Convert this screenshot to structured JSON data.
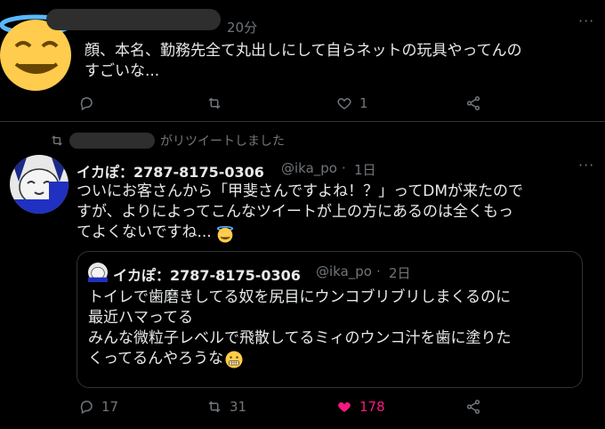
{
  "tweet1": {
    "time": "20分",
    "text_line1": "顔、本名、勤務先全て丸出しにして自らネットの玩具やってんの",
    "text_line2": "すごいな...",
    "retweet_count": "",
    "like_count": "1"
  },
  "retweet_banner": {
    "label": "がリツイートしました"
  },
  "tweet2": {
    "name": "イカぽ：2787-8175-0306",
    "handle": "@ika_po",
    "time": "1日",
    "text_line1": "ついにお客さんから「甲斐さんですよね！？」ってDMが来たので",
    "text_line2": "すが、よりによってこんなツイートが上の方にあるのは全くもっ",
    "text_line3": "てよくないですね...",
    "reply_count": "17",
    "retweet_count": "31",
    "like_count": "178"
  },
  "quoted": {
    "name": "イカぽ：2787-8175-0306",
    "handle": "@ika_po",
    "time": "2日",
    "text_line1": "トイレで歯磨きしてる奴を尻目にウンコブリブリしまくるのに",
    "text_line2": "最近ハマってる",
    "text_line3": "みんな微粒子レベルで飛散してるミィのウンコ汁を歯に塗りた",
    "text_line4": "くってるんやろうな"
  },
  "colors": {
    "like": "#f91880",
    "muted": "#71767b",
    "text": "#e7e9ea",
    "border": "#2f3336"
  }
}
